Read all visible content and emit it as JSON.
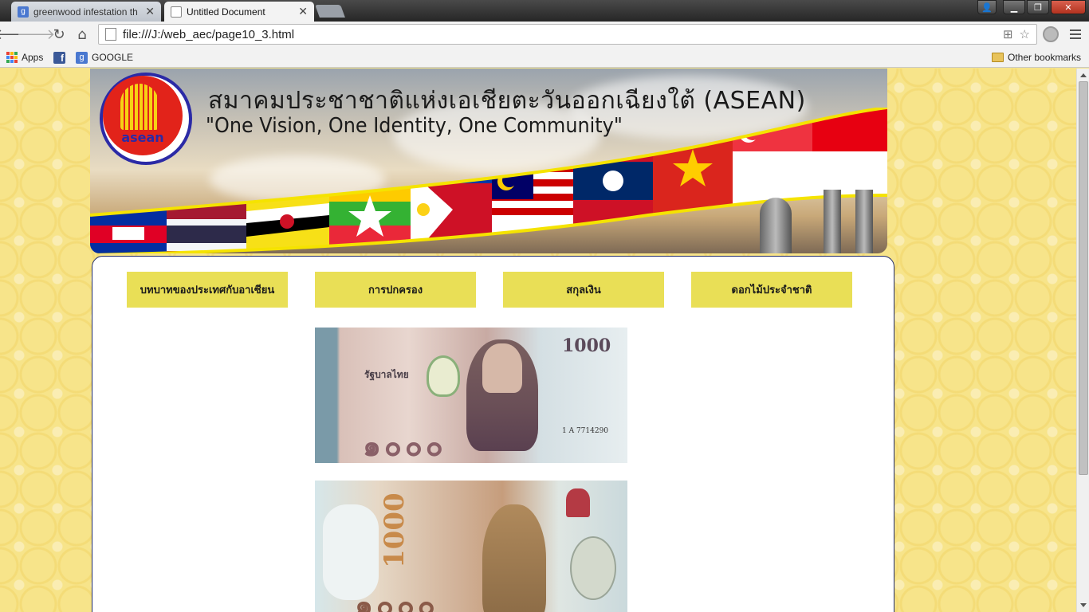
{
  "browser": {
    "tabs": [
      {
        "title": "greenwood infestation th",
        "active": false,
        "favicon": "google-icon"
      },
      {
        "title": "Untitled Document",
        "active": true,
        "favicon": "page-icon"
      }
    ],
    "url": "file:///J:/web_aec/page10_3.html",
    "bookmarks": [
      {
        "label": "Apps",
        "icon": "apps-grid-icon"
      },
      {
        "label": "",
        "icon": "facebook-icon"
      },
      {
        "label": "GOOGLE",
        "icon": "google-icon"
      }
    ],
    "other_bookmarks": "Other bookmarks"
  },
  "banner": {
    "title": "สมาคมประชาชาติแห่งเอเชียตะวันออกเฉียงใต้ (ASEAN)",
    "slogan": "\"One Vision, One Identity, One Community\"",
    "logo_text": "asean"
  },
  "menu": [
    {
      "label": "บทบาทของประเทศกับอาเซียน"
    },
    {
      "label": "การปกครอง"
    },
    {
      "label": "สกุลเงิน"
    },
    {
      "label": "ดอกไม้ประจำชาติ"
    }
  ],
  "banknotes": {
    "front_value": "1000",
    "front_serial": "1 A 7714290",
    "front_bank": "รัฐบาลไทย",
    "back_value": "1000"
  },
  "colors": {
    "page_bg": "#f7e48a",
    "menu_bg": "#e9df56",
    "panel_border": "#1f2a6b"
  }
}
